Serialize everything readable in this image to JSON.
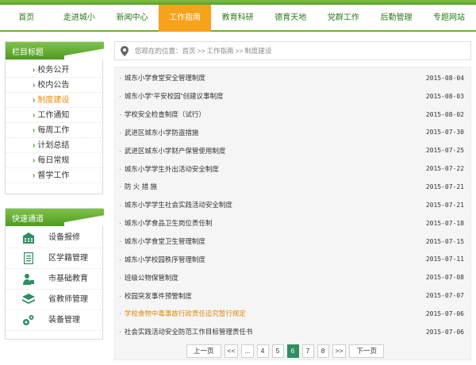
{
  "nav": {
    "items": [
      "首页",
      "走进城小",
      "新闻中心",
      "工作指南",
      "教育科研",
      "德育天地",
      "党群工作",
      "后勤管理",
      "专题网站"
    ],
    "active_index": 3
  },
  "sidebar": {
    "categories_title": "栏目标题",
    "categories": [
      "校务公开",
      "校内公告",
      "制度建设",
      "工作通知",
      "每周工作",
      "计划总结",
      "每日常规",
      "督学工作"
    ],
    "current_category_index": 2,
    "quick_title": "快速通道",
    "quick_links": [
      {
        "label": "设备报修",
        "icon": "building-icon"
      },
      {
        "label": "区学籍管理",
        "icon": "document-icon"
      },
      {
        "label": "市基础教育",
        "icon": "teacher-icon"
      },
      {
        "label": "省教师管理",
        "icon": "layers-icon"
      },
      {
        "label": "装备管理",
        "icon": "gears-icon"
      }
    ]
  },
  "breadcrumb": {
    "prefix": "您现在的位置：",
    "items": [
      "首页",
      "工作指南",
      "制度建设"
    ],
    "separator": ">>"
  },
  "articles": [
    {
      "title": "城东小学食堂安全管理制度",
      "date": "2015-08-04"
    },
    {
      "title": "城东小学“平安校园”创建议事制度",
      "date": "2015-08-03"
    },
    {
      "title": "学校安全检查制度（试行）",
      "date": "2015-08-02"
    },
    {
      "title": "武进区城东小学防盗措施",
      "date": "2015-07-30"
    },
    {
      "title": "武进区城东小学财产保管使用制度",
      "date": "2015-07-25"
    },
    {
      "title": "城东小学学生外出活动安全制度",
      "date": "2015-07-22"
    },
    {
      "title": "防 火 措 施",
      "date": "2015-07-21"
    },
    {
      "title": "城东小学学生社会实践活动安全制度",
      "date": "2015-07-21"
    },
    {
      "title": "城东小学食品卫生岗位责任制",
      "date": "2015-07-18"
    },
    {
      "title": "城东小学食堂卫生管理制度",
      "date": "2015-07-15"
    },
    {
      "title": "城东小学校园秩序管理制度",
      "date": "2015-07-11"
    },
    {
      "title": "班级公物保管制度",
      "date": "2015-07-08"
    },
    {
      "title": "校园突发事件预警制度",
      "date": "2015-07-07"
    },
    {
      "title": "学校食物中毒事故行政责任追究暂行规定",
      "date": "2015-07-06"
    },
    {
      "title": "社会实践活动安全防范工作目标管理责任书",
      "date": "2015-07-06"
    }
  ],
  "highlighted_article_index": 13,
  "pagination": {
    "prev": "上一页",
    "first_group": "<<",
    "ellipsis": "...",
    "pages": [
      "4",
      "5",
      "6",
      "7",
      "8"
    ],
    "current_page": "6",
    "next_group": ">>",
    "next": "下一页"
  },
  "colors": {
    "brand_green": "#4f9a23",
    "active_orange": "#f6a21a",
    "highlight_text": "#e08a00",
    "current_page": "#2f8f63"
  }
}
